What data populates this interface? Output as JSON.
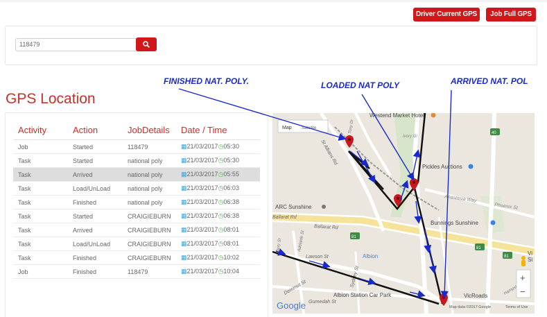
{
  "header": {
    "driver_gps_label": "Driver Current GPS",
    "job_gps_label": "Job Full GPS"
  },
  "search": {
    "value": "118479",
    "button_icon": "search-icon"
  },
  "page_title": "GPS Location",
  "table": {
    "headers": [
      "Activity",
      "Action",
      "JobDetails",
      "Date / Time"
    ],
    "rows": [
      {
        "activity": "Job",
        "action": "Started",
        "details": "118479",
        "date": "21/03/2017",
        "time": "05:30"
      },
      {
        "activity": "Task",
        "action": "Started",
        "details": "national poly",
        "date": "21/03/2017",
        "time": "05:30"
      },
      {
        "activity": "Task",
        "action": "Arrived",
        "details": "national poly",
        "date": "21/03/2017",
        "time": "05:55"
      },
      {
        "activity": "Task",
        "action": "Load/UnLoad",
        "details": "national poly",
        "date": "21/03/2017",
        "time": "06:03"
      },
      {
        "activity": "Task",
        "action": "Finished",
        "details": "national poly",
        "date": "21/03/2017",
        "time": "06:38"
      },
      {
        "activity": "Task",
        "action": "Started",
        "details": "CRAIGIEBURN",
        "date": "21/03/2017",
        "time": "06:38"
      },
      {
        "activity": "Task",
        "action": "Arrived",
        "details": "CRAIGIEBURN",
        "date": "21/03/2017",
        "time": "08:01"
      },
      {
        "activity": "Task",
        "action": "Load/UnLoad",
        "details": "CRAIGIEBURN",
        "date": "21/03/2017",
        "time": "08:01"
      },
      {
        "activity": "Task",
        "action": "Finished",
        "details": "CRAIGIEBURN",
        "date": "21/03/2017",
        "time": "10:02"
      },
      {
        "activity": "Job",
        "action": "Finished",
        "details": "118479",
        "date": "21/03/2017",
        "time": "10:04"
      }
    ],
    "highlighted_row": 2
  },
  "map": {
    "tabs": [
      "Map",
      "Satellite"
    ],
    "places": [
      "Westend Market Hotel",
      "Pickles Auctions",
      "Anastasia Way",
      "Phoenix St",
      "ARC Sunshine",
      "Bunnings Sunshine",
      "Ballarat Rd",
      "Ballarat Rd",
      "Lawson St",
      "Albion",
      "Derrimut St",
      "Sydney St",
      "Gurnedah St",
      "Albion Station Car Park",
      "VicRoads",
      "Vi",
      "Si",
      "St Albans Rd",
      "Ivory Gr",
      "Adelaide St",
      "Albury St",
      "Hampshire Rd",
      "Tony Dr",
      "40",
      "81",
      "81",
      "81"
    ],
    "google": "Google",
    "attribution": "Map data ©2017 Google",
    "terms": "Terms of Use",
    "zoom_in": "+",
    "zoom_out": "−"
  },
  "annotations": {
    "finished": "FINISHED NAT. POLY.",
    "loaded": "LOADED NAT POLY",
    "arrived": "ARRIVED NAT. POL"
  },
  "colors": {
    "accent_red": "#d0181a",
    "heading_red": "#c9302c",
    "annotation_blue": "#1a29c9",
    "route_black": "#111111"
  }
}
